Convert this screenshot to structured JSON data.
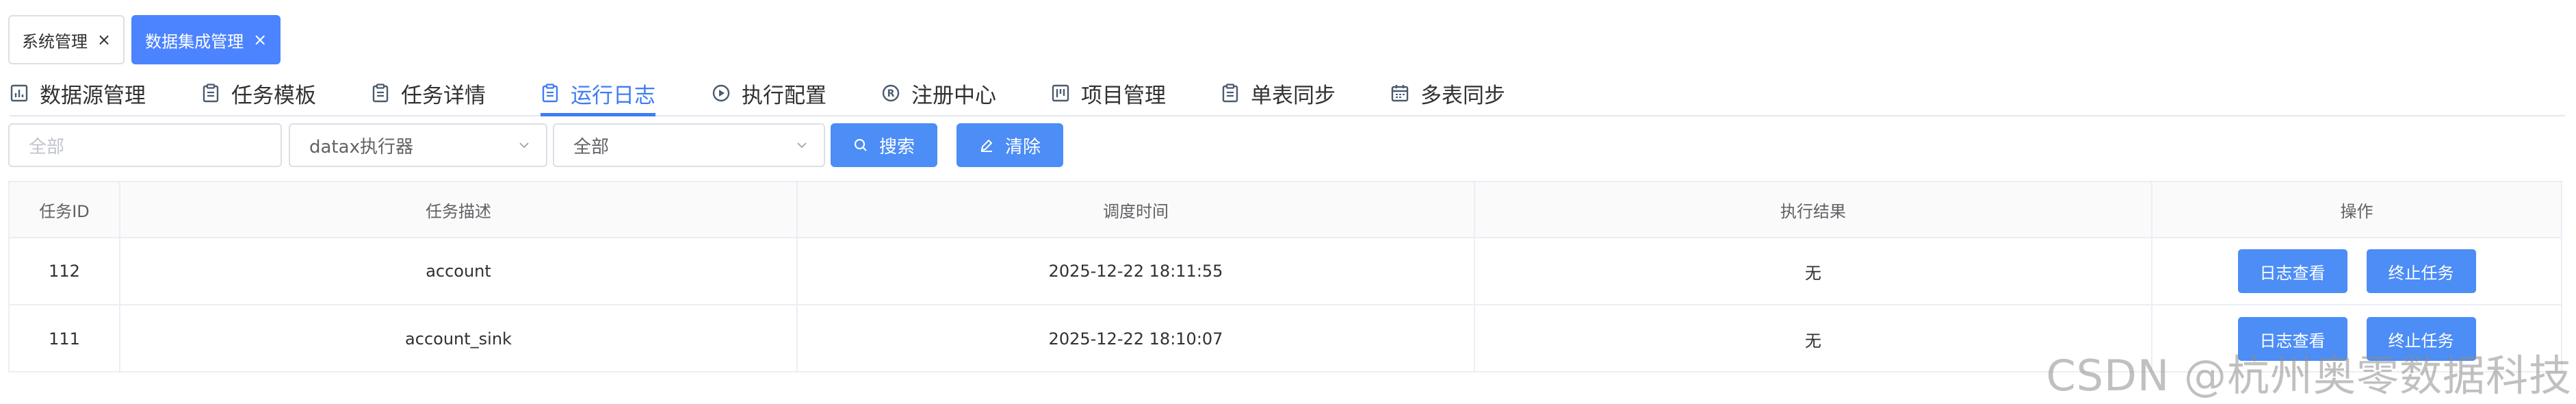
{
  "tags": [
    {
      "label": "系统管理",
      "active": false
    },
    {
      "label": "数据集成管理",
      "active": true
    }
  ],
  "tabs": [
    {
      "label": "数据源管理",
      "icon": "chart-doc-icon"
    },
    {
      "label": "任务模板",
      "icon": "clipboard-icon"
    },
    {
      "label": "任务详情",
      "icon": "clipboard-icon"
    },
    {
      "label": "运行日志",
      "icon": "clipboard-icon",
      "active": true
    },
    {
      "label": "执行配置",
      "icon": "play-circle-icon"
    },
    {
      "label": "注册中心",
      "icon": "registered-icon"
    },
    {
      "label": "项目管理",
      "icon": "kanban-icon"
    },
    {
      "label": "单表同步",
      "icon": "clipboard-icon"
    },
    {
      "label": "多表同步",
      "icon": "calendar-icon"
    }
  ],
  "filters": {
    "status_placeholder": "全部",
    "executor_value": "datax执行器",
    "result_value": "全部",
    "search_label": "搜索",
    "clear_label": "清除"
  },
  "table": {
    "headers": [
      "任务ID",
      "任务描述",
      "调度时间",
      "执行结果",
      "操作"
    ],
    "rows": [
      {
        "id": "112",
        "desc": "account",
        "time": "2025-12-22 18:11:55",
        "result": "无"
      },
      {
        "id": "111",
        "desc": "account_sink",
        "time": "2025-12-22 18:10:07",
        "result": "无"
      }
    ],
    "actions": {
      "view_log": "日志查看",
      "stop_task": "终止任务"
    }
  },
  "watermark": "CSDN @杭州奥零数据科技",
  "colors": {
    "accent": "#4c8df6",
    "tab_active": "#3f7cf6",
    "border": "#ebeef5"
  }
}
